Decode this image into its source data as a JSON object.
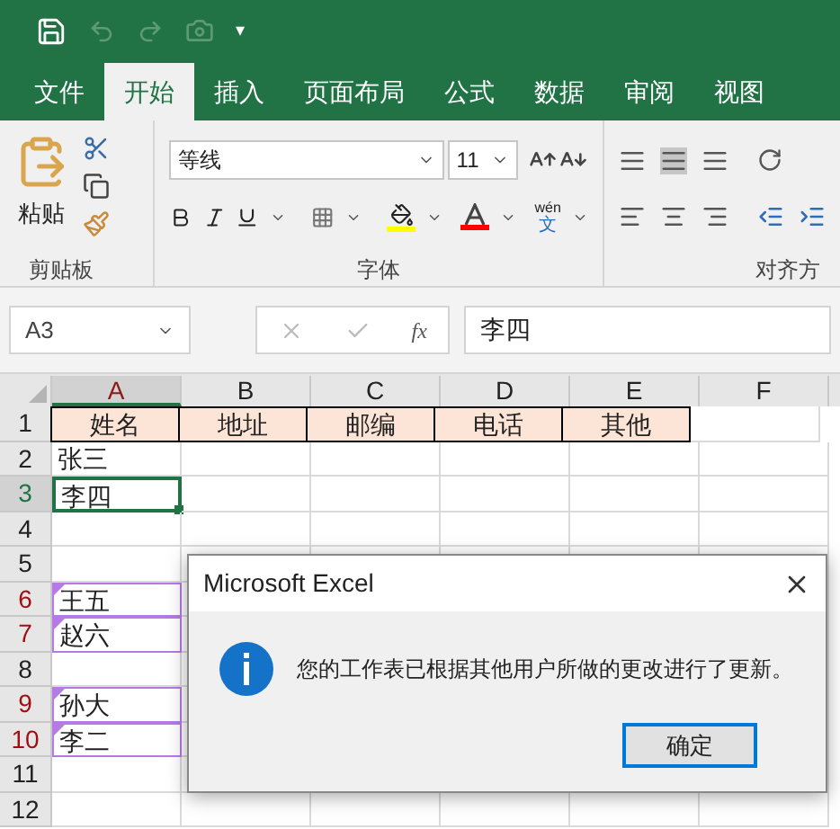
{
  "quick_access": {
    "customize": "▾"
  },
  "tabs": [
    {
      "label": "文件",
      "selected": false
    },
    {
      "label": "开始",
      "selected": true
    },
    {
      "label": "插入",
      "selected": false
    },
    {
      "label": "页面布局",
      "selected": false
    },
    {
      "label": "公式",
      "selected": false
    },
    {
      "label": "数据",
      "selected": false
    },
    {
      "label": "审阅",
      "selected": false
    },
    {
      "label": "视图",
      "selected": false
    }
  ],
  "ribbon": {
    "paste": "粘贴",
    "clipboard_label": "剪贴板",
    "font_name": "等线",
    "font_size": "11",
    "font_label": "字体",
    "phonetic_top": "wén",
    "phonetic_bottom": "文",
    "alignment_label": "对齐方"
  },
  "formula_bar": {
    "name_box": "A3",
    "fx": "fx",
    "value": "李四"
  },
  "columns": [
    {
      "label": "A",
      "selected": true
    },
    {
      "label": "B",
      "selected": false
    },
    {
      "label": "C",
      "selected": false
    },
    {
      "label": "D",
      "selected": false
    },
    {
      "label": "E",
      "selected": false
    },
    {
      "label": "F",
      "selected": false
    }
  ],
  "rows": [
    {
      "number": "1",
      "kind": "header",
      "selected": false,
      "changed": false,
      "cells": [
        "姓名",
        "地址",
        "邮编",
        "电话",
        "其他"
      ]
    },
    {
      "number": "2",
      "kind": "data",
      "selected": false,
      "changed": false,
      "cells": [
        "张三"
      ]
    },
    {
      "number": "3",
      "kind": "data",
      "selected": true,
      "changed": false,
      "cells": [
        "李四"
      ]
    },
    {
      "number": "4",
      "kind": "data",
      "selected": false,
      "changed": false
    },
    {
      "number": "5",
      "kind": "data",
      "selected": false,
      "changed": false
    },
    {
      "number": "6",
      "kind": "data",
      "selected": false,
      "changed": true,
      "cells": [
        "王五"
      ]
    },
    {
      "number": "7",
      "kind": "data",
      "selected": false,
      "changed": true,
      "cells": [
        "赵六"
      ]
    },
    {
      "number": "8",
      "kind": "data",
      "selected": false,
      "changed": false
    },
    {
      "number": "9",
      "kind": "data",
      "selected": false,
      "changed": true,
      "cells": [
        "孙大"
      ]
    },
    {
      "number": "10",
      "kind": "data",
      "selected": false,
      "changed": true,
      "cells": [
        "李二"
      ]
    },
    {
      "number": "11",
      "kind": "data",
      "selected": false,
      "changed": false
    },
    {
      "number": "12",
      "kind": "data",
      "selected": false,
      "changed": false
    }
  ],
  "dialog": {
    "title": "Microsoft Excel",
    "message": "您的工作表已根据其他用户所做的更改进行了更新。",
    "button": "确定"
  }
}
